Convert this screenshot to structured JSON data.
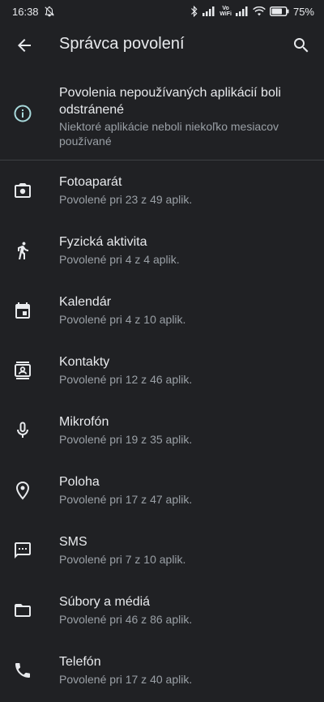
{
  "status_bar": {
    "time": "16:38",
    "volte_top": "Vo",
    "volte_bottom": "WiFi",
    "battery": "75%"
  },
  "app_bar": {
    "title": "Správca povolení"
  },
  "notice": {
    "title": "Povolenia nepoužívaných aplikácií boli odstránené",
    "subtitle": "Niektoré aplikácie neboli niekoľko mesiacov používané"
  },
  "permissions": [
    {
      "label": "Fotoaparát",
      "detail": "Povolené pri 23 z 49 aplik.",
      "icon": "camera-icon"
    },
    {
      "label": "Fyzická aktivita",
      "detail": "Povolené pri 4 z 4 aplik.",
      "icon": "walking-icon"
    },
    {
      "label": "Kalendár",
      "detail": "Povolené pri 4 z 10 aplik.",
      "icon": "calendar-icon"
    },
    {
      "label": "Kontakty",
      "detail": "Povolené pri 12 z 46 aplik.",
      "icon": "contacts-icon"
    },
    {
      "label": "Mikrofón",
      "detail": "Povolené pri 19 z 35 aplik.",
      "icon": "microphone-icon"
    },
    {
      "label": "Poloha",
      "detail": "Povolené pri 17 z 47 aplik.",
      "icon": "location-icon"
    },
    {
      "label": "SMS",
      "detail": "Povolené pri 7 z 10 aplik.",
      "icon": "sms-icon"
    },
    {
      "label": "Súbory a médiá",
      "detail": "Povolené pri 46 z 86 aplik.",
      "icon": "folder-icon"
    },
    {
      "label": "Telefón",
      "detail": "Povolené pri 17 z 40 aplik.",
      "icon": "phone-icon"
    }
  ],
  "colors": {
    "background": "#202124",
    "primary_text": "#e8eaed",
    "secondary_text": "#9aa0a6",
    "info_icon": "#a8dadc"
  }
}
